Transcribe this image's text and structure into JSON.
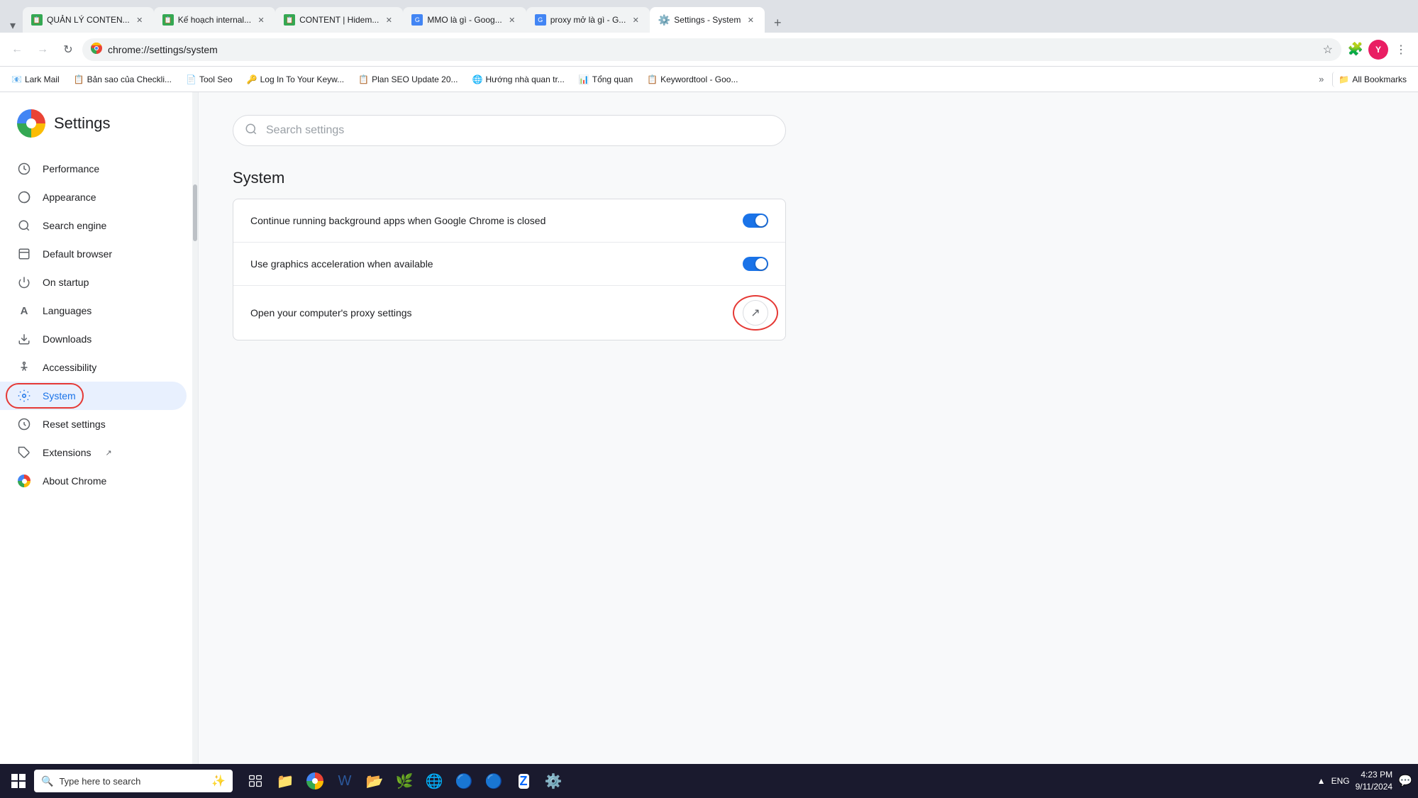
{
  "browser": {
    "tabs": [
      {
        "id": "tab1",
        "label": "QUẢN LÝ CONTEN...",
        "active": false,
        "color": "#34a853"
      },
      {
        "id": "tab2",
        "label": "Kế hoạch internal...",
        "active": false,
        "color": "#34a853"
      },
      {
        "id": "tab3",
        "label": "CONTENT | Hidem...",
        "active": false,
        "color": "#34a853"
      },
      {
        "id": "tab4",
        "label": "MMO là gì - Goog...",
        "active": false,
        "color": "#4285f4"
      },
      {
        "id": "tab5",
        "label": "proxy mở là gì - G...",
        "active": false,
        "color": "#4285f4"
      },
      {
        "id": "tab6",
        "label": "Settings - System",
        "active": true,
        "color": "#5f6368"
      }
    ],
    "address": "chrome://settings/system",
    "browser_name": "Chrome"
  },
  "bookmarks": [
    {
      "label": "Lark Mail",
      "icon": "📧"
    },
    {
      "label": "Bản sao của Checkli...",
      "icon": "📋"
    },
    {
      "label": "Tool Seo",
      "icon": "📄"
    },
    {
      "label": "Log In To Your Keyw...",
      "icon": "🔑"
    },
    {
      "label": "Plan SEO Update 20...",
      "icon": "📋"
    },
    {
      "label": "Hướng nhà quan tr...",
      "icon": "🌐"
    },
    {
      "label": "Tổng quan",
      "icon": "📊"
    },
    {
      "label": "Keywordtool - Goo...",
      "icon": "📋"
    },
    {
      "label": "All Bookmarks",
      "icon": "📁"
    }
  ],
  "settings": {
    "title": "Settings",
    "search_placeholder": "Search settings",
    "nav_items": [
      {
        "id": "performance",
        "label": "Performance",
        "icon": "⚡"
      },
      {
        "id": "appearance",
        "label": "Appearance",
        "icon": "🎨"
      },
      {
        "id": "search-engine",
        "label": "Search engine",
        "icon": "🔍"
      },
      {
        "id": "default-browser",
        "label": "Default browser",
        "icon": "📋"
      },
      {
        "id": "on-startup",
        "label": "On startup",
        "icon": "⏻"
      },
      {
        "id": "languages",
        "label": "Languages",
        "icon": "A"
      },
      {
        "id": "downloads",
        "label": "Downloads",
        "icon": "⬇"
      },
      {
        "id": "accessibility",
        "label": "Accessibility",
        "icon": "♿"
      },
      {
        "id": "system",
        "label": "System",
        "icon": "⚙",
        "active": true
      },
      {
        "id": "reset-settings",
        "label": "Reset settings",
        "icon": "↺"
      },
      {
        "id": "extensions",
        "label": "Extensions",
        "icon": "🧩",
        "external": true
      },
      {
        "id": "about-chrome",
        "label": "About Chrome",
        "icon": "ℹ"
      }
    ],
    "section_title": "System",
    "rows": [
      {
        "id": "background-apps",
        "label": "Continue running background apps when Google Chrome is closed",
        "type": "toggle",
        "enabled": true
      },
      {
        "id": "graphics-acceleration",
        "label": "Use graphics acceleration when available",
        "type": "toggle",
        "enabled": true
      },
      {
        "id": "proxy-settings",
        "label": "Open your computer's proxy settings",
        "type": "external-link"
      }
    ]
  },
  "taskbar": {
    "search_placeholder": "Type here to search",
    "time": "4:23 PM",
    "date": "9/11/2024",
    "language": "ENG"
  }
}
